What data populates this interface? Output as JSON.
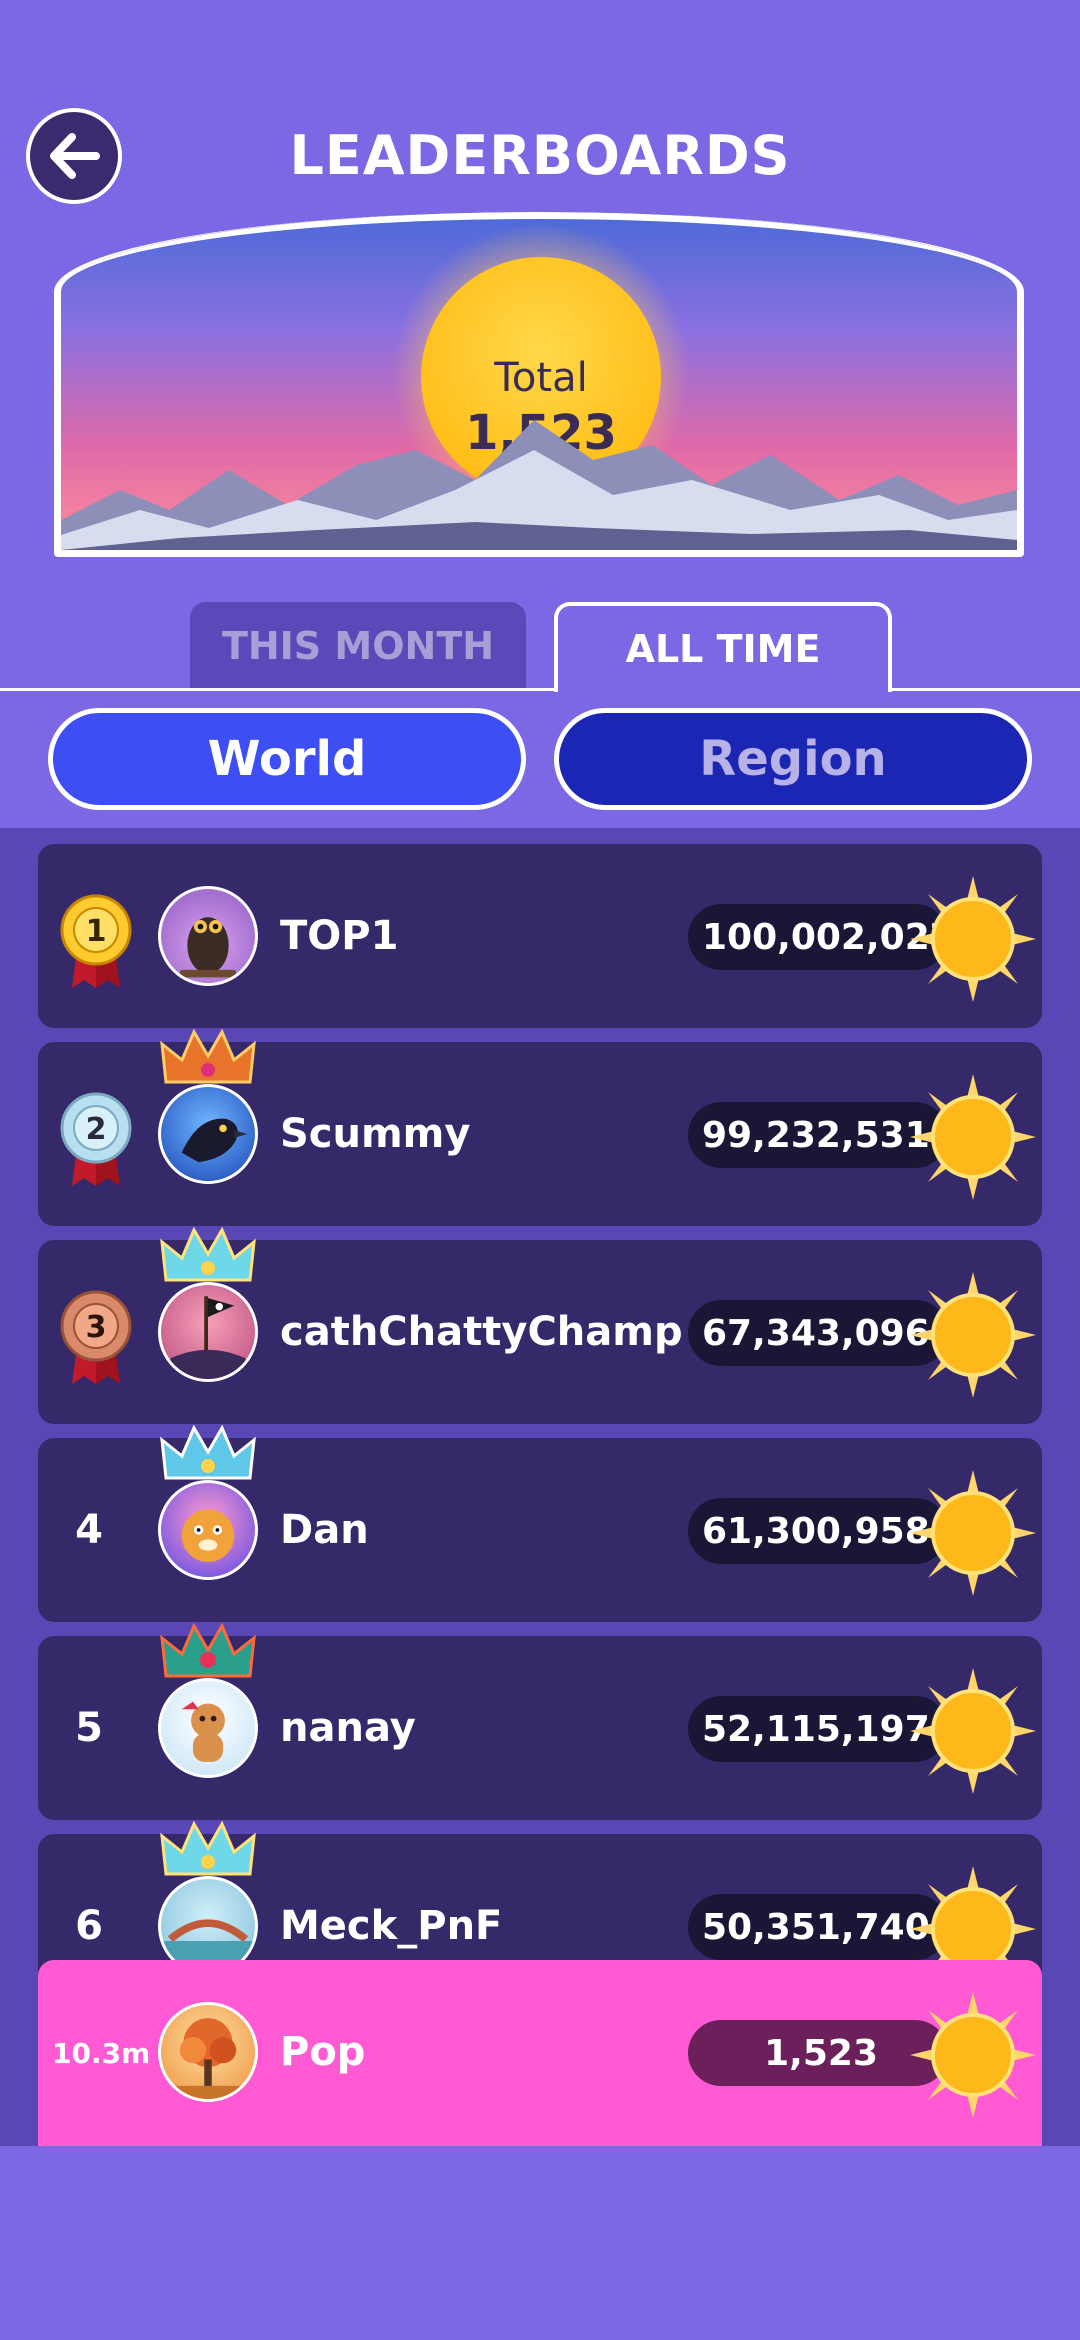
{
  "header": {
    "title": "LEADERBOARDS",
    "back_icon": "arrow-left-icon"
  },
  "banner": {
    "total_label": "Total",
    "total_value": "1,523"
  },
  "tabs": [
    {
      "label": "THIS MONTH",
      "active": false
    },
    {
      "label": "ALL TIME",
      "active": true
    }
  ],
  "filters": [
    {
      "label": "World",
      "active": true
    },
    {
      "label": "Region",
      "active": false
    }
  ],
  "rows": [
    {
      "rank": "1",
      "name": "TOP1",
      "score": "100,002,027",
      "medal": "gold"
    },
    {
      "rank": "2",
      "name": "Scummy",
      "score": "99,232,531",
      "medal": "silver"
    },
    {
      "rank": "3",
      "name": "cathChattyChamp",
      "score": "67,343,096",
      "medal": "bronze"
    },
    {
      "rank": "4",
      "name": "Dan",
      "score": "61,300,958"
    },
    {
      "rank": "5",
      "name": "nanay",
      "score": "52,115,197"
    },
    {
      "rank": "6",
      "name": "Meck_PnF",
      "score": "50,351,740"
    }
  ],
  "self": {
    "rank": "10.3m",
    "name": "Pop",
    "score": "1,523"
  },
  "colors": {
    "background": "#7c68e4",
    "row": "#35296a",
    "self_row": "#ff5ad3",
    "world_button": "#3d4ef5",
    "region_button": "#1c26b4"
  }
}
